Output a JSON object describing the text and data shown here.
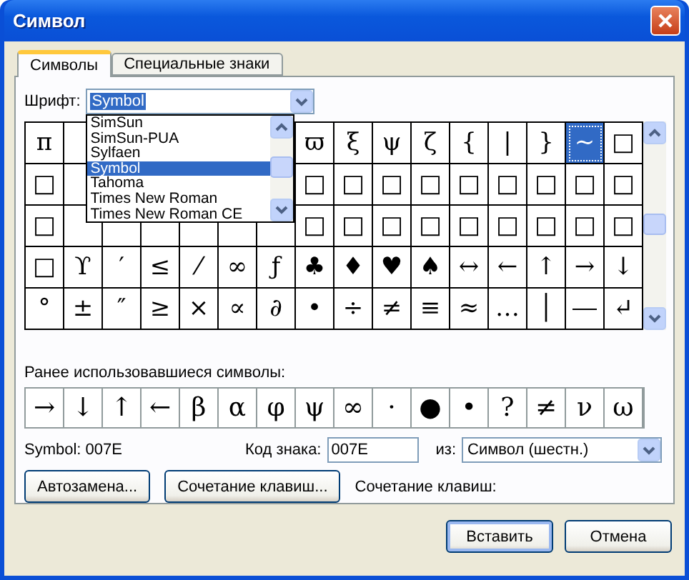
{
  "window": {
    "title": "Символ"
  },
  "tabs": [
    {
      "label": "Символы",
      "selected": true
    },
    {
      "label": "Специальные знаки",
      "selected": false
    }
  ],
  "font": {
    "label": "Шрифт:",
    "value": "Symbol",
    "expanded": true,
    "options": [
      {
        "label": "SimSun",
        "selected": false
      },
      {
        "label": "SimSun-PUA",
        "selected": false
      },
      {
        "label": "Sylfaen",
        "selected": false
      },
      {
        "label": "Symbol",
        "selected": true
      },
      {
        "label": "Tahoma",
        "selected": false
      },
      {
        "label": "Times New Roman",
        "selected": false
      },
      {
        "label": "Times New Roman CE",
        "selected": false
      }
    ]
  },
  "grid": [
    {
      "cells": [
        {
          "char": "π",
          "selected": false
        },
        {
          "char": "ϖ",
          "selected": false
        },
        {
          "char": "ξ",
          "selected": false
        },
        {
          "char": "ψ",
          "selected": false
        },
        {
          "char": "ζ",
          "selected": false
        },
        {
          "char": "{",
          "selected": false
        },
        {
          "char": "|",
          "selected": false
        },
        {
          "char": "}",
          "selected": false
        },
        {
          "char": "~",
          "selected": true
        },
        {
          "char": "□",
          "selected": false
        }
      ]
    },
    {
      "cells": [
        {
          "char": "□",
          "selected": false
        },
        {
          "char": "□",
          "selected": false
        },
        {
          "char": "□",
          "selected": false
        },
        {
          "char": "□",
          "selected": false
        },
        {
          "char": "□",
          "selected": false
        },
        {
          "char": "□",
          "selected": false
        },
        {
          "char": "□",
          "selected": false
        },
        {
          "char": "□",
          "selected": false
        },
        {
          "char": "□",
          "selected": false
        },
        {
          "char": "□",
          "selected": false
        }
      ]
    },
    {
      "cells": [
        {
          "char": "□",
          "selected": false
        },
        {
          "char": "□",
          "selected": false
        },
        {
          "char": "□",
          "selected": false
        },
        {
          "char": "□",
          "selected": false
        },
        {
          "char": "□",
          "selected": false
        },
        {
          "char": "□",
          "selected": false
        },
        {
          "char": "□",
          "selected": false
        },
        {
          "char": "□",
          "selected": false
        },
        {
          "char": "□",
          "selected": false
        },
        {
          "char": "□",
          "selected": false
        }
      ]
    },
    {
      "cells": [
        {
          "char": "□",
          "selected": false
        },
        {
          "char": "ϒ",
          "selected": false
        },
        {
          "char": "′",
          "selected": false
        },
        {
          "char": "≤",
          "selected": false
        },
        {
          "char": "⁄",
          "selected": false
        },
        {
          "char": "∞",
          "selected": false
        },
        {
          "char": "ƒ",
          "selected": false
        },
        {
          "char": "♣",
          "selected": false
        },
        {
          "char": "♦",
          "selected": false
        },
        {
          "char": "♥",
          "selected": false
        },
        {
          "char": "♠",
          "selected": false
        },
        {
          "char": "↔",
          "selected": false
        },
        {
          "char": "←",
          "selected": false
        },
        {
          "char": "↑",
          "selected": false
        },
        {
          "char": "→",
          "selected": false
        },
        {
          "char": "↓",
          "selected": false
        }
      ]
    },
    {
      "cells": [
        {
          "char": "°",
          "selected": false
        },
        {
          "char": "±",
          "selected": false
        },
        {
          "char": "″",
          "selected": false
        },
        {
          "char": "≥",
          "selected": false
        },
        {
          "char": "×",
          "selected": false
        },
        {
          "char": "∝",
          "selected": false
        },
        {
          "char": "∂",
          "selected": false
        },
        {
          "char": "•",
          "selected": false
        },
        {
          "char": "÷",
          "selected": false
        },
        {
          "char": "≠",
          "selected": false
        },
        {
          "char": "≡",
          "selected": false
        },
        {
          "char": "≈",
          "selected": false
        },
        {
          "char": "…",
          "selected": false
        },
        {
          "char": "│",
          "selected": false
        },
        {
          "char": "―",
          "selected": false
        },
        {
          "char": "↵",
          "selected": false
        }
      ]
    }
  ],
  "recent": {
    "label": "Ранее использовавшиеся символы:",
    "chars": [
      "→",
      "↓",
      "↑",
      "←",
      "β",
      "α",
      "φ",
      "ψ",
      "∞",
      "·",
      "●",
      "•",
      "?",
      "≠",
      "ν",
      "ω"
    ]
  },
  "info": {
    "name": "Symbol: 007E",
    "code_label": "Код знака:",
    "code": "007E",
    "from_label": "из:",
    "from": "Символ (шестн.)"
  },
  "buttons": [
    "Автозамена...",
    "Сочетание клавиш..."
  ],
  "shortcut_label": "Сочетание клавиш:",
  "footer": [
    "Вставить",
    "Отмена"
  ]
}
